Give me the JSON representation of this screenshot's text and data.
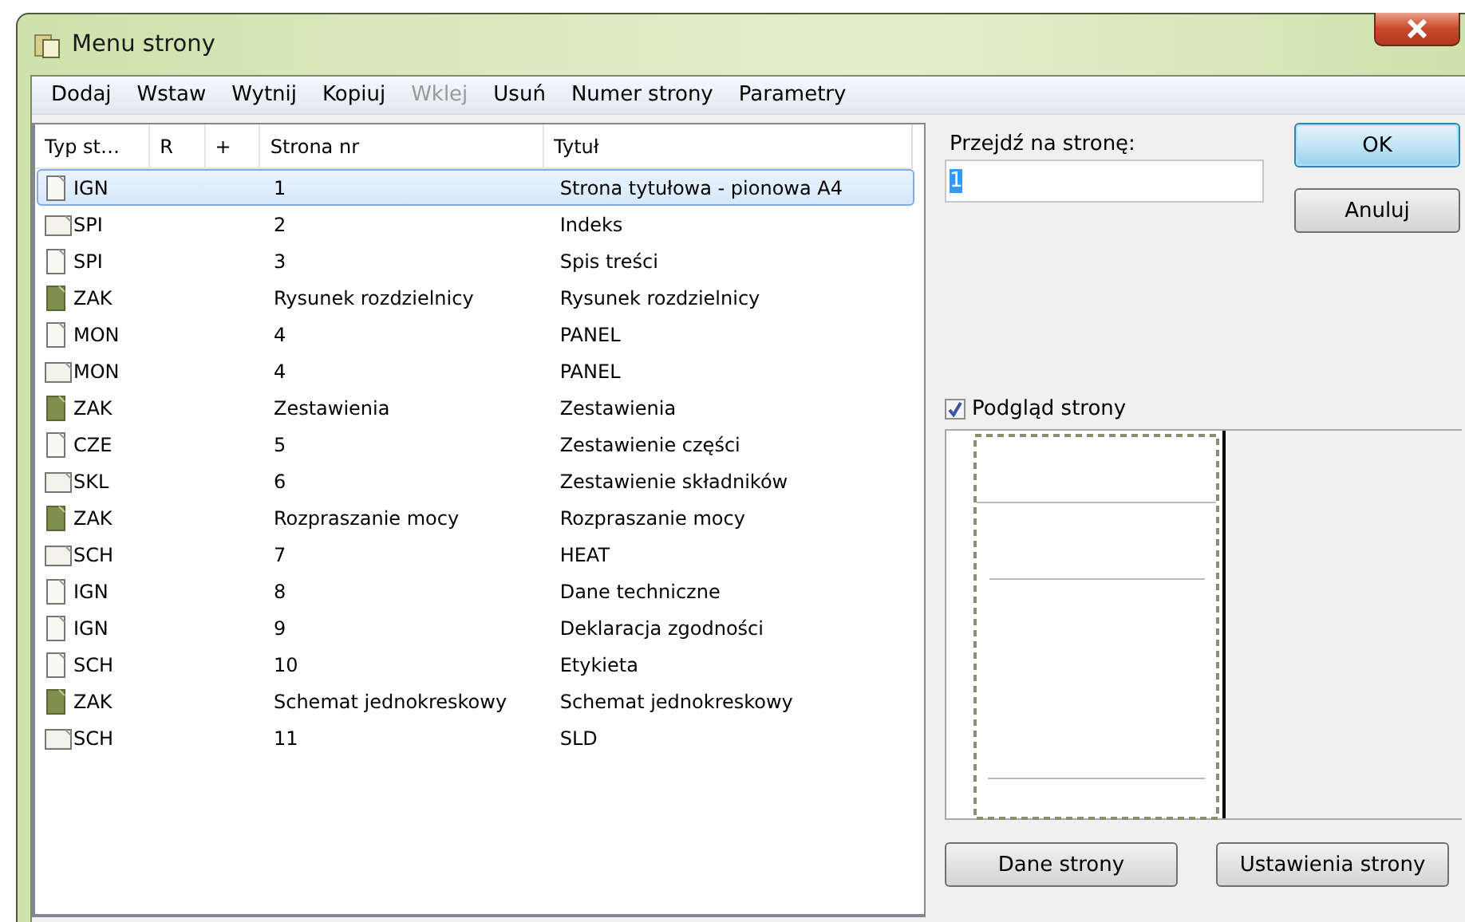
{
  "window": {
    "title": "Menu strony"
  },
  "menu": [
    {
      "label": "Dodaj",
      "disabled": false
    },
    {
      "label": "Wstaw",
      "disabled": false
    },
    {
      "label": "Wytnij",
      "disabled": false
    },
    {
      "label": "Kopiuj",
      "disabled": false
    },
    {
      "label": "Wklej",
      "disabled": true
    },
    {
      "label": "Usuń",
      "disabled": false
    },
    {
      "label": "Numer strony",
      "disabled": false
    },
    {
      "label": "Parametry",
      "disabled": false
    }
  ],
  "table": {
    "columns": [
      "Typ st…",
      "R",
      "+",
      "Strona nr",
      "Tytuł"
    ],
    "rows": [
      {
        "kind": "portrait",
        "type": "IGN",
        "page": "1",
        "title": "Strona tytułowa - pionowa A4",
        "selected": true
      },
      {
        "kind": "landscape",
        "type": "SPI",
        "page": "2",
        "title": "Indeks",
        "selected": false
      },
      {
        "kind": "portrait",
        "type": "SPI",
        "page": "3",
        "title": "Spis treści",
        "selected": false
      },
      {
        "kind": "section",
        "type": "ZAK",
        "page": "Rysunek rozdzielnicy",
        "title": "Rysunek rozdzielnicy",
        "selected": false
      },
      {
        "kind": "portrait",
        "type": "MON",
        "page": "4",
        "title": "PANEL",
        "selected": false
      },
      {
        "kind": "landscape",
        "type": "MON",
        "page": "4",
        "title": "PANEL",
        "selected": false
      },
      {
        "kind": "section",
        "type": "ZAK",
        "page": "Zestawienia",
        "title": "Zestawienia",
        "selected": false
      },
      {
        "kind": "portrait",
        "type": "CZE",
        "page": "5",
        "title": "Zestawienie części",
        "selected": false
      },
      {
        "kind": "landscape",
        "type": "SKL",
        "page": "6",
        "title": "Zestawienie składników",
        "selected": false
      },
      {
        "kind": "section",
        "type": "ZAK",
        "page": "Rozpraszanie mocy",
        "title": "Rozpraszanie mocy",
        "selected": false
      },
      {
        "kind": "landscape",
        "type": "SCH",
        "page": "7",
        "title": "HEAT",
        "selected": false
      },
      {
        "kind": "portrait",
        "type": "IGN",
        "page": "8",
        "title": "Dane techniczne",
        "selected": false
      },
      {
        "kind": "portrait",
        "type": "IGN",
        "page": "9",
        "title": "Deklaracja zgodności",
        "selected": false
      },
      {
        "kind": "portrait",
        "type": "SCH",
        "page": "10",
        "title": "Etykieta",
        "selected": false
      },
      {
        "kind": "section",
        "type": "ZAK",
        "page": "Schemat jednokreskowy",
        "title": "Schemat jednokreskowy",
        "selected": false
      },
      {
        "kind": "landscape",
        "type": "SCH",
        "page": "11",
        "title": "SLD",
        "selected": false
      }
    ]
  },
  "goto": {
    "label": "Przejdź na stronę:",
    "value": "1"
  },
  "buttons": [
    {
      "label": "OK",
      "default": true
    },
    {
      "label": "Anuluj",
      "default": false
    }
  ],
  "preview": {
    "label": "Podgląd strony",
    "checked": true
  },
  "bottom_buttons": [
    "Dane strony",
    "Ustawienia strony"
  ]
}
